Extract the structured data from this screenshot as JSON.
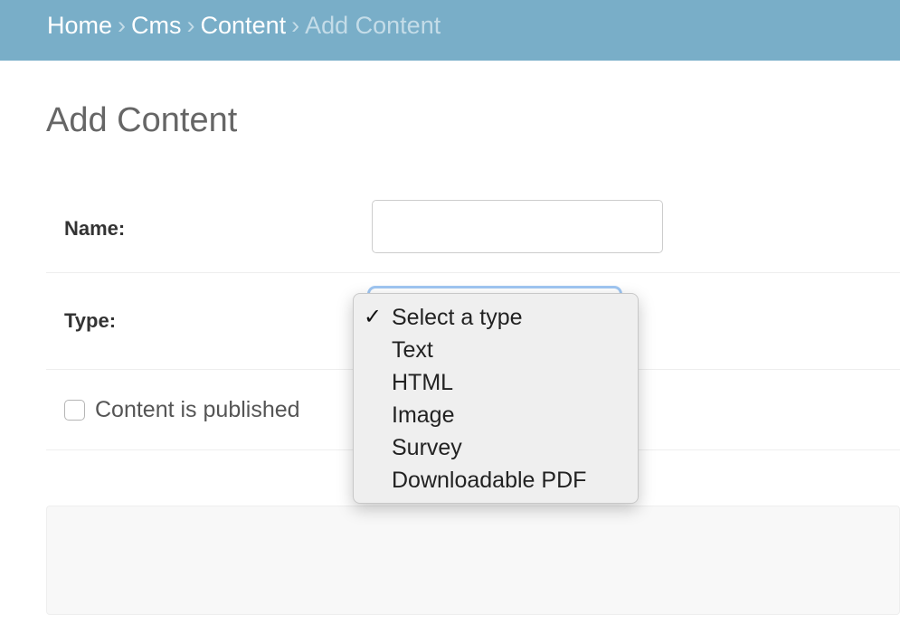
{
  "breadcrumbs": {
    "items": [
      "Home",
      "Cms",
      "Content"
    ],
    "current": "Add Content",
    "separator": "›"
  },
  "page": {
    "title": "Add Content"
  },
  "form": {
    "name_label": "Name:",
    "name_value": "",
    "type_label": "Type:",
    "published_label": "Content is published",
    "published_checked": false
  },
  "type_dropdown": {
    "selected_index": 0,
    "options": [
      "Select a type",
      "Text",
      "HTML",
      "Image",
      "Survey",
      "Downloadable PDF"
    ]
  },
  "icons": {
    "selected_mark": "✓"
  },
  "colors": {
    "header": "#79aec8",
    "focus_ring": "#9fc6f2"
  }
}
